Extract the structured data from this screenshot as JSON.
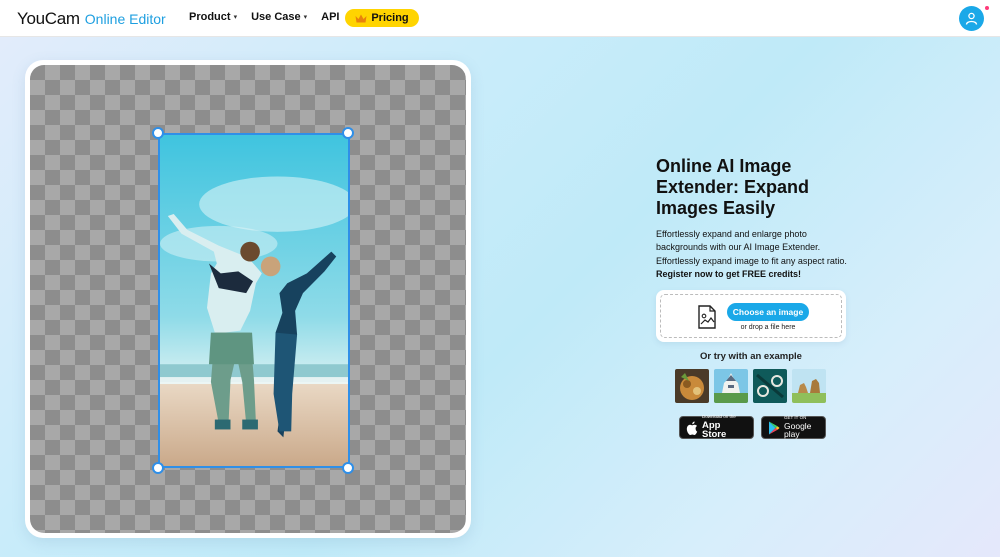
{
  "header": {
    "logo_main": "YouCam",
    "logo_sub": "Online Editor",
    "nav": {
      "product": "Product",
      "use_case": "Use Case",
      "api": "API"
    },
    "pricing_label": "Pricing"
  },
  "hero": {
    "title": "Online AI Image Extender: Expand Images Easily",
    "desc_line1": "Effortlessly expand and enlarge photo backgrounds with our AI Image Extender. Effortlessly expand image to fit any aspect ratio.",
    "desc_bold": "Register now to get FREE credits!"
  },
  "upload": {
    "button_label": "Choose an image",
    "drop_text": "or drop a file here"
  },
  "examples": {
    "label": "Or try with an example",
    "items": [
      "food-thumbnail",
      "castle-thumbnail",
      "jewelry-thumbnail",
      "camels-thumbnail"
    ]
  },
  "stores": {
    "appstore_small": "Download on the",
    "appstore_big": "App Store",
    "google_small": "GET IT ON",
    "google_big": "Google play"
  },
  "colors": {
    "accent": "#1aa8e8",
    "brand_blue": "#1e9fe0",
    "pricing_yellow": "#ffd400",
    "selection_blue": "#2f8fe8"
  }
}
